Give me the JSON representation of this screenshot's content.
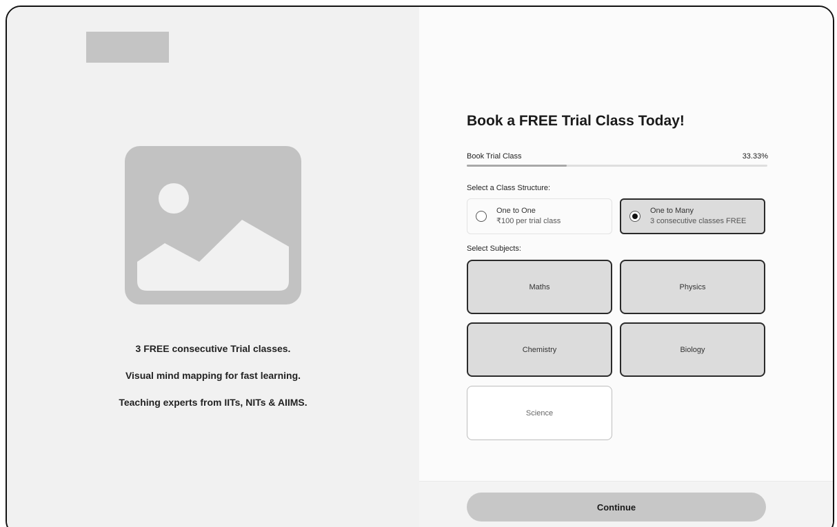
{
  "left_panel": {
    "features": [
      "3 FREE consecutive Trial classes.",
      "Visual mind mapping for fast learning.",
      "Teaching experts from IITs, NITs & AIIMS."
    ]
  },
  "form": {
    "title": "Book a FREE Trial Class Today!",
    "progress": {
      "label": "Book Trial Class",
      "value_text": "33.33%",
      "fraction": 0.3333
    },
    "class_structure": {
      "label": "Select a Class Structure:",
      "options": [
        {
          "title": "One to One",
          "subtitle": "₹100 per trial class",
          "selected": false
        },
        {
          "title": "One to Many",
          "subtitle": "3 consecutive classes FREE",
          "selected": true
        }
      ]
    },
    "subjects": {
      "label": "Select Subjects:",
      "items": [
        {
          "name": "Maths",
          "selected": true
        },
        {
          "name": "Physics",
          "selected": true
        },
        {
          "name": "Chemistry",
          "selected": true
        },
        {
          "name": "Biology",
          "selected": true
        },
        {
          "name": "Science",
          "selected": false
        }
      ]
    },
    "continue_label": "Continue"
  },
  "colors": {
    "selected_fill": "#dcdcdc",
    "selected_border": "#2a2a2a",
    "button_fill": "#c7c7c7"
  }
}
